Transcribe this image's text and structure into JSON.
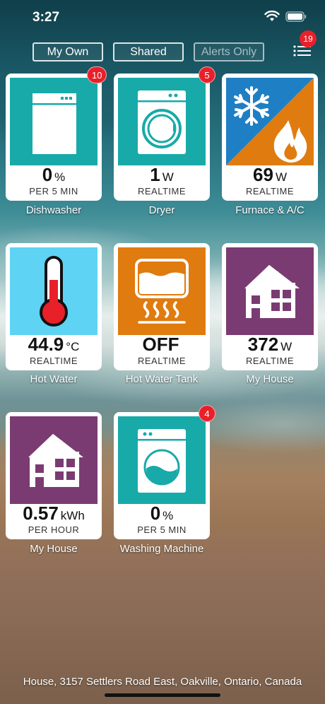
{
  "status_bar": {
    "time": "3:27"
  },
  "filters": [
    {
      "label": "My Own"
    },
    {
      "label": "Shared"
    },
    {
      "label": "Alerts Only"
    }
  ],
  "menu": {
    "badge": "19",
    "icon": "list-menu-icon"
  },
  "tiles": [
    {
      "name": "Dishwasher",
      "value": "0",
      "unit": "%",
      "period": "PER 5 MIN",
      "badge": "10",
      "icon": "dishwasher-icon",
      "bg": "#17aaa9"
    },
    {
      "name": "Dryer",
      "value": "1",
      "unit": "W",
      "period": "REALTIME",
      "badge": "5",
      "icon": "dryer-icon",
      "bg": "#17aaa9"
    },
    {
      "name": "Furnace & A/C",
      "value": "69",
      "unit": "W",
      "period": "REALTIME",
      "badge": "",
      "icon": "snowflake-flame-icon",
      "bg": "#1f7fc4"
    },
    {
      "name": "Hot Water",
      "value": "44.9",
      "unit": "°C",
      "period": "REALTIME",
      "badge": "",
      "icon": "thermometer-icon",
      "bg": "#5ed3f3"
    },
    {
      "name": "Hot Water Tank",
      "value": "OFF",
      "unit": "",
      "period": "REALTIME",
      "badge": "",
      "icon": "water-tank-icon",
      "bg": "#e07b10"
    },
    {
      "name": "My House",
      "value": "372",
      "unit": "W",
      "period": "REALTIME",
      "badge": "",
      "icon": "house-icon",
      "bg": "#7a3b72"
    },
    {
      "name": "My House",
      "value": "0.57",
      "unit": "kWh",
      "period": "PER HOUR",
      "badge": "",
      "icon": "house-icon",
      "bg": "#7a3b72"
    },
    {
      "name": "Washing Machine",
      "value": "0",
      "unit": "%",
      "period": "PER 5 MIN",
      "badge": "4",
      "icon": "washing-machine-icon",
      "bg": "#17aaa9"
    }
  ],
  "footer": {
    "address": "House, 3157 Settlers Road East, Oakville, Ontario, Canada"
  }
}
